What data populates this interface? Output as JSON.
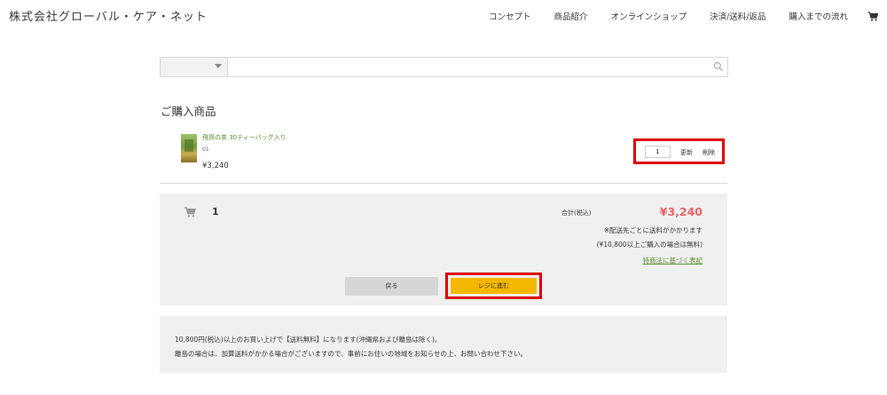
{
  "header": {
    "brand": "株式会社グローバル・ケア・ネット",
    "nav": [
      "コンセプト",
      "商品紹介",
      "オンラインショップ",
      "決済/送料/返品",
      "購入までの流れ"
    ],
    "cart_icon": "cart-icon"
  },
  "search": {
    "category_value": "",
    "placeholder": "",
    "icon": "search-icon"
  },
  "cart": {
    "title": "ご購入商品",
    "items": [
      {
        "name": "飛鳥の茶 30ティーバッグ入り",
        "variant": "01",
        "price": "¥3,240",
        "quantity": "1",
        "update_label": "更新",
        "delete_label": "削除"
      }
    ],
    "summary": {
      "item_count": "1",
      "total_label": "合計(税込)",
      "total_amount": "¥3,240",
      "shipping_note": "※配送先ごとに送料がかかります",
      "free_shipping_note": "(¥10,800以上ご購入の場合は無料)",
      "law_link": "特商法に基づく表記",
      "back_label": "戻る",
      "checkout_label": "レジに進む"
    }
  },
  "info": {
    "line1": "10,800円(税込)以上のお買い上げで【送料無料】になります(沖縄県および離島は除く)。",
    "line2": "離島の場合は、加算送料がかかる場合がございますので、事前にお住いの地域をお知らせの上、お問い合わせ下さい。"
  },
  "colors": {
    "accent_red": "#e86262",
    "link_green": "#5a8a2a",
    "checkout_yellow": "#f5b800",
    "highlight_red": "#e00000"
  }
}
